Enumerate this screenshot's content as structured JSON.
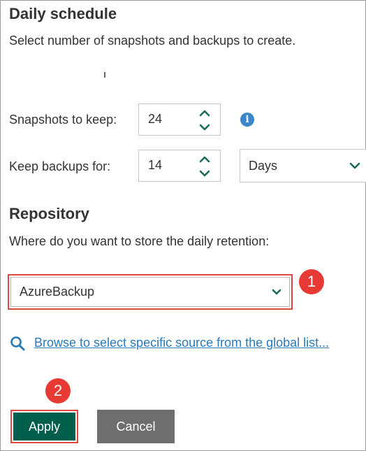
{
  "daily_schedule": {
    "title": "Daily schedule",
    "description": "Select number of snapshots and backups to create."
  },
  "snapshots": {
    "label": "Snapshots to keep:",
    "value": "24"
  },
  "backups": {
    "label": "Keep backups for:",
    "value": "14",
    "unit": "Days"
  },
  "repository": {
    "title": "Repository",
    "description": "Where do you want to store the daily retention:",
    "selected": "AzureBackup"
  },
  "browse_link": "Browse to select specific source from the global list...",
  "buttons": {
    "apply": "Apply",
    "cancel": "Cancel"
  },
  "badges": {
    "first": "1",
    "second": "2"
  },
  "colors": {
    "primary_green": "#005f4b",
    "accent_green": "#1d6a5a",
    "link_blue": "#2a7ab8",
    "highlight_red": "#e0473f",
    "badge_red": "#e83a34",
    "cancel_gray": "#6d6e70"
  },
  "icons": {
    "info": "info-icon",
    "search": "search-icon",
    "spin_up": "chevron-up-icon",
    "spin_down": "chevron-down-icon",
    "dropdown": "chevron-down-icon"
  }
}
